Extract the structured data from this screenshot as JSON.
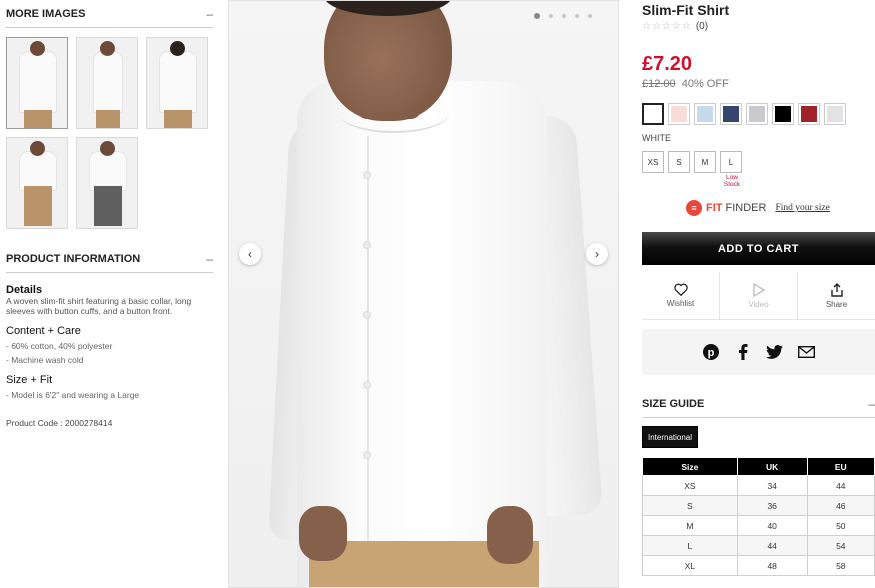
{
  "left": {
    "more_images": {
      "title": "MORE IMAGES",
      "toggle": "–"
    },
    "product_info": {
      "title": "PRODUCT INFORMATION",
      "toggle": "–",
      "details_heading": "Details",
      "details_text": "A woven slim-fit shirt featuring a basic collar, long sleeves with button cuffs, and a button front.",
      "content_heading": "Content + Care",
      "content_items": [
        "- 60% cotton, 40% polyester",
        "- Machine wash cold"
      ],
      "size_heading": "Size + Fit",
      "size_items": [
        "- Model is 6'2\" and wearing a Large"
      ],
      "product_code": "Product Code : 2000278414"
    }
  },
  "gallery": {
    "prev_icon": "‹",
    "next_icon": "›",
    "dot_count": 5
  },
  "product": {
    "title": "Slim-Fit Shirt",
    "stars": "☆☆☆☆☆",
    "review_count": "(0)",
    "price": "£7.20",
    "old_price": "£12.00",
    "discount": "40% OFF",
    "color_name": "WHITE",
    "swatches": [
      "#ffffff",
      "#f9dcd8",
      "#c7d9ec",
      "#34466e",
      "#c9c9ce",
      "#000000",
      "#a0232a",
      "#e3e3e5"
    ],
    "sizes": [
      "XS",
      "S",
      "M",
      "L"
    ],
    "low_stock": "Low Stock",
    "fit_finder": {
      "part1": "FIT",
      "part2": "FINDER",
      "link": "Find your size"
    },
    "add_to_cart": "ADD TO CART",
    "actions": {
      "wishlist": "Wishlist",
      "video": "Video",
      "share": "Share"
    }
  },
  "size_guide": {
    "title": "SIZE GUIDE",
    "toggle": "–",
    "tab": "International",
    "headers": [
      "Size",
      "UK",
      "EU"
    ],
    "rows": [
      [
        "XS",
        "34",
        "44"
      ],
      [
        "S",
        "36",
        "46"
      ],
      [
        "M",
        "40",
        "50"
      ],
      [
        "L",
        "44",
        "54"
      ],
      [
        "XL",
        "48",
        "58"
      ]
    ]
  },
  "colors": {
    "accent": "#d0102e",
    "fit_brand": "#e8473a"
  }
}
